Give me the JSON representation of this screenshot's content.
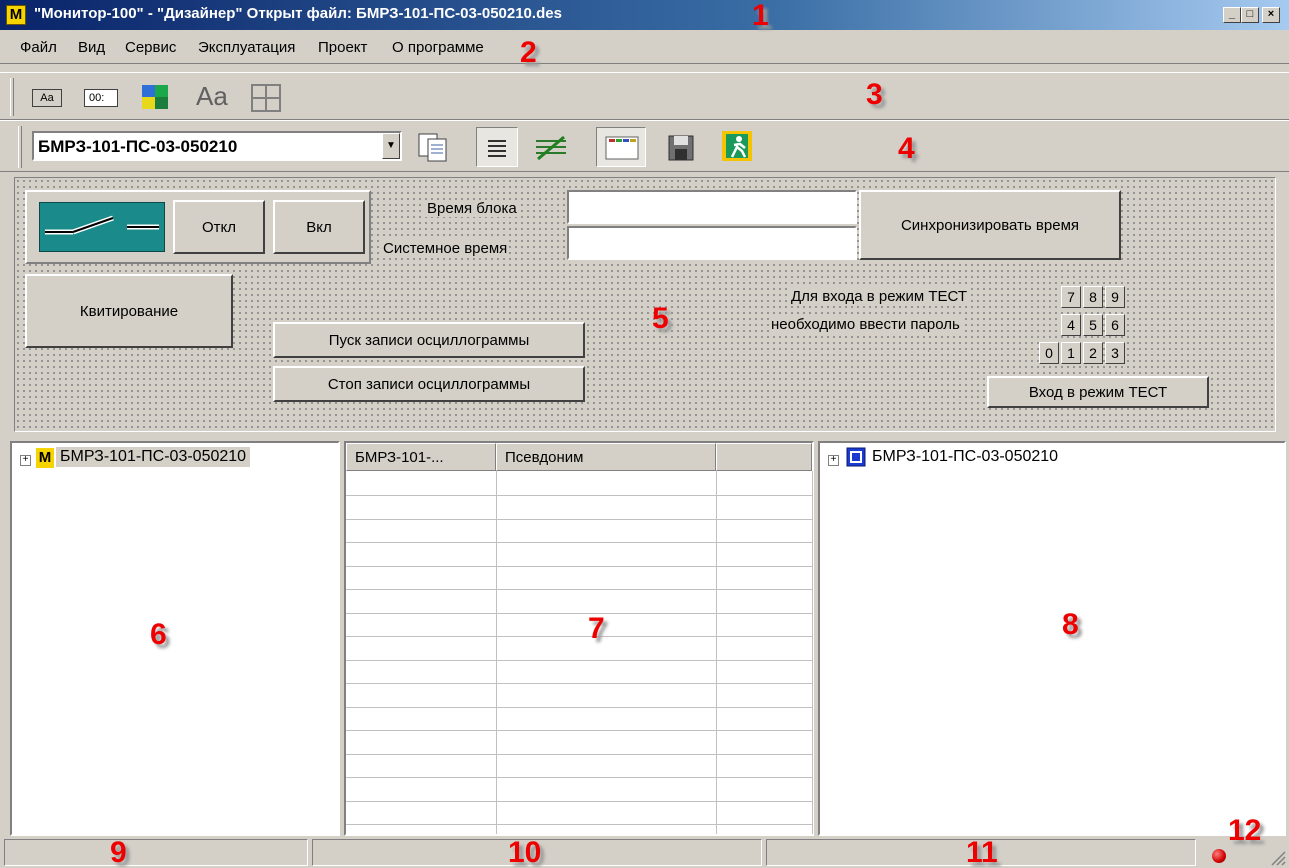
{
  "window": {
    "title": "\"Монитор-100\" - \"Дизайнер\" Открыт файл: БМРЗ-101-ПС-03-050210.des",
    "icon_letter": "M",
    "caption_buttons": [
      "minimize-icon",
      "maximize-icon",
      "close-icon"
    ]
  },
  "menu": {
    "items": [
      {
        "label": "Файл"
      },
      {
        "label": "Вид"
      },
      {
        "label": "Сервис"
      },
      {
        "label": "Эксплуатация"
      },
      {
        "label": "Проект"
      },
      {
        "label": "О программе"
      }
    ]
  },
  "toolbar1": {
    "icons": [
      "label-aa-icon",
      "time-field-icon",
      "color-palette-icon",
      "font-aa-icon",
      "grid-layout-icon"
    ],
    "aa_small": "Aa",
    "time_small": "00:",
    "aa_large": "Aa"
  },
  "toolbar2": {
    "device_select_value": "БМРЗ-101-ПС-03-050210",
    "icons": [
      "copy-pages-icon",
      "dot-grid-icon",
      "hatched-grid-icon",
      "window-panel-icon",
      "save-floppy-icon",
      "exit-door-icon"
    ]
  },
  "panel": {
    "switch_icon": "breaker-switch-icon",
    "off_label": "Откл",
    "on_label": "Вкл",
    "block_time_label": "Время блока",
    "system_time_label": "Системное время",
    "block_time_value": "",
    "system_time_value": "",
    "sync_label": "Синхронизировать время",
    "ack_label": "Квитирование",
    "osc_start_label": "Пуск записи осциллограммы",
    "osc_stop_label": "Стоп записи осциллограммы",
    "test_hint_line1": "Для входа в режим ТЕСТ",
    "test_hint_line2": "необходимо ввести пароль",
    "keypad": [
      [
        "7",
        "8",
        "9"
      ],
      [
        "4",
        "5",
        "6"
      ],
      [
        "0",
        "1",
        "2",
        "3"
      ]
    ],
    "test_enter_label": "Вход в режим ТЕСТ"
  },
  "left_tree": {
    "expander": "+",
    "node_label": "БМРЗ-101-ПС-03-050210",
    "node_icon": "monitor-m-icon"
  },
  "grid": {
    "columns": [
      "БМРЗ-101-...",
      "Псевдоним",
      ""
    ]
  },
  "right_tree": {
    "expander": "+",
    "node_label": "БМРЗ-101-ПС-03-050210",
    "node_icon": "device-block-icon"
  },
  "status_bar": {
    "cells": [
      "",
      "",
      ""
    ],
    "indicator": "red-led-icon"
  },
  "callouts": [
    "1",
    "2",
    "3",
    "4",
    "5",
    "6",
    "7",
    "8",
    "9",
    "10",
    "11",
    "12"
  ],
  "colors": {
    "titlebar_start": "#0a246a",
    "titlebar_end": "#a6caf0",
    "face": "#d4d0c8",
    "callout": "#e00000"
  }
}
